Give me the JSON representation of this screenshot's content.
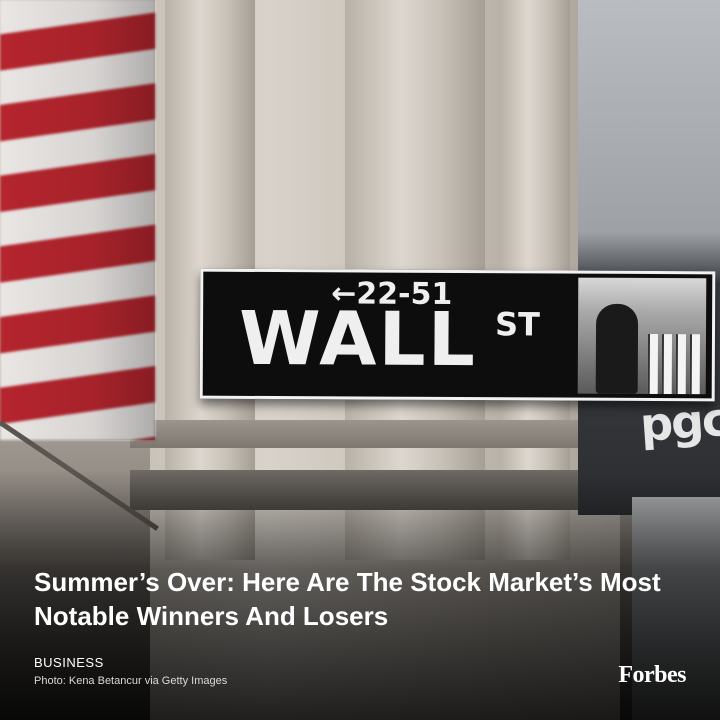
{
  "photo": {
    "sign": {
      "arrow_text": "←22-51",
      "street_name": "WALL",
      "street_suffix": "ST"
    },
    "banner_text": "pgc"
  },
  "article": {
    "headline": "Summer’s Over: Here Are The Stock Market’s Most Notable Winners And Losers",
    "category": "BUSINESS",
    "photo_credit": "Photo: Kena Betancur via Getty Images"
  },
  "brand": {
    "logo": "Forbes"
  },
  "colors": {
    "flag_red": "#b5252e",
    "flag_white": "#e9e6e4",
    "sign_background": "#0d0d0d",
    "text": "#ffffff"
  }
}
